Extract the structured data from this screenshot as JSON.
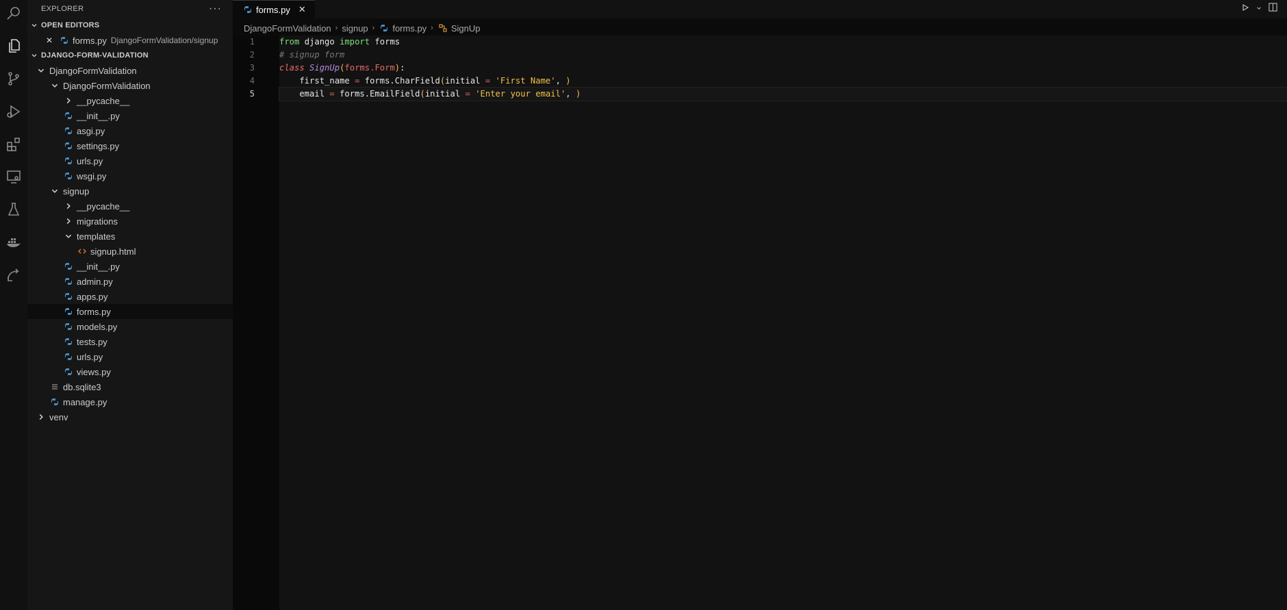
{
  "activity_bar": [
    "search-icon",
    "files-icon",
    "source-control-icon",
    "run-debug-icon",
    "extensions-icon",
    "remote-explorer-icon",
    "testing-icon",
    "docker-icon",
    "live-share-icon"
  ],
  "sidebar": {
    "title": "EXPLORER",
    "more": "···",
    "open_editors": {
      "label": "OPEN EDITORS",
      "items": [
        {
          "close": "✕",
          "name": "forms.py",
          "path": "DjangoFormValidation/signup"
        }
      ]
    },
    "project": {
      "label": "DJANGO-FORM-VALIDATION",
      "tree": [
        {
          "name": "DjangoFormValidation",
          "type": "folder-open"
        },
        {
          "name": "DjangoFormValidation",
          "type": "folder-open"
        },
        {
          "name": "__pycache__",
          "type": "folder"
        },
        {
          "name": "__init__.py",
          "type": "py"
        },
        {
          "name": "asgi.py",
          "type": "py"
        },
        {
          "name": "settings.py",
          "type": "py"
        },
        {
          "name": "urls.py",
          "type": "py"
        },
        {
          "name": "wsgi.py",
          "type": "py"
        },
        {
          "name": "signup",
          "type": "folder-open"
        },
        {
          "name": "__pycache__",
          "type": "folder"
        },
        {
          "name": "migrations",
          "type": "folder"
        },
        {
          "name": "templates",
          "type": "folder-open"
        },
        {
          "name": "signup.html",
          "type": "html"
        },
        {
          "name": "__init__.py",
          "type": "py"
        },
        {
          "name": "admin.py",
          "type": "py"
        },
        {
          "name": "apps.py",
          "type": "py"
        },
        {
          "name": "forms.py",
          "type": "py",
          "selected": true
        },
        {
          "name": "models.py",
          "type": "py"
        },
        {
          "name": "tests.py",
          "type": "py"
        },
        {
          "name": "urls.py",
          "type": "py"
        },
        {
          "name": "views.py",
          "type": "py"
        },
        {
          "name": "db.sqlite3",
          "type": "db"
        },
        {
          "name": "manage.py",
          "type": "py"
        },
        {
          "name": "venv",
          "type": "folder"
        }
      ]
    }
  },
  "tab": {
    "name": "forms.py",
    "close": "✕"
  },
  "breadcrumb": [
    "DjangoFormValidation",
    "signup",
    "forms.py",
    "SignUp"
  ],
  "editor": {
    "line_numbers": [
      "1",
      "2",
      "3",
      "4",
      "5"
    ],
    "lines": [
      {
        "tokens": [
          [
            "kw",
            "from"
          ],
          [
            "id",
            " django "
          ],
          [
            "kw",
            "import"
          ],
          [
            "id",
            " forms"
          ]
        ]
      },
      {
        "tokens": [
          [
            "cm",
            "# signup form"
          ]
        ]
      },
      {
        "tokens": [
          [
            "kw2",
            "class"
          ],
          [
            "id",
            " "
          ],
          [
            "cls",
            "SignUp"
          ],
          [
            "par",
            "("
          ],
          [
            "base",
            "forms"
          ],
          [
            "op",
            "."
          ],
          [
            "base",
            "Form"
          ],
          [
            "par",
            ")"
          ],
          [
            "id",
            ":"
          ]
        ]
      },
      {
        "tokens": [
          [
            "id",
            "    first_name "
          ],
          [
            "op",
            "="
          ],
          [
            "id",
            " forms.CharField"
          ],
          [
            "par",
            "("
          ],
          [
            "id",
            "initial "
          ],
          [
            "op",
            "="
          ],
          [
            "id",
            " "
          ],
          [
            "str",
            "'First Name'"
          ],
          [
            "id",
            ", "
          ],
          [
            "par",
            ")"
          ]
        ]
      },
      {
        "tokens": [
          [
            "id",
            "    email "
          ],
          [
            "op",
            "="
          ],
          [
            "id",
            " forms.EmailField"
          ],
          [
            "par",
            "("
          ],
          [
            "id",
            "initial "
          ],
          [
            "op",
            "="
          ],
          [
            "id",
            " "
          ],
          [
            "str",
            "'Enter your email'"
          ],
          [
            "id",
            ", "
          ],
          [
            "par",
            ")"
          ]
        ]
      }
    ],
    "current_line": 5
  }
}
